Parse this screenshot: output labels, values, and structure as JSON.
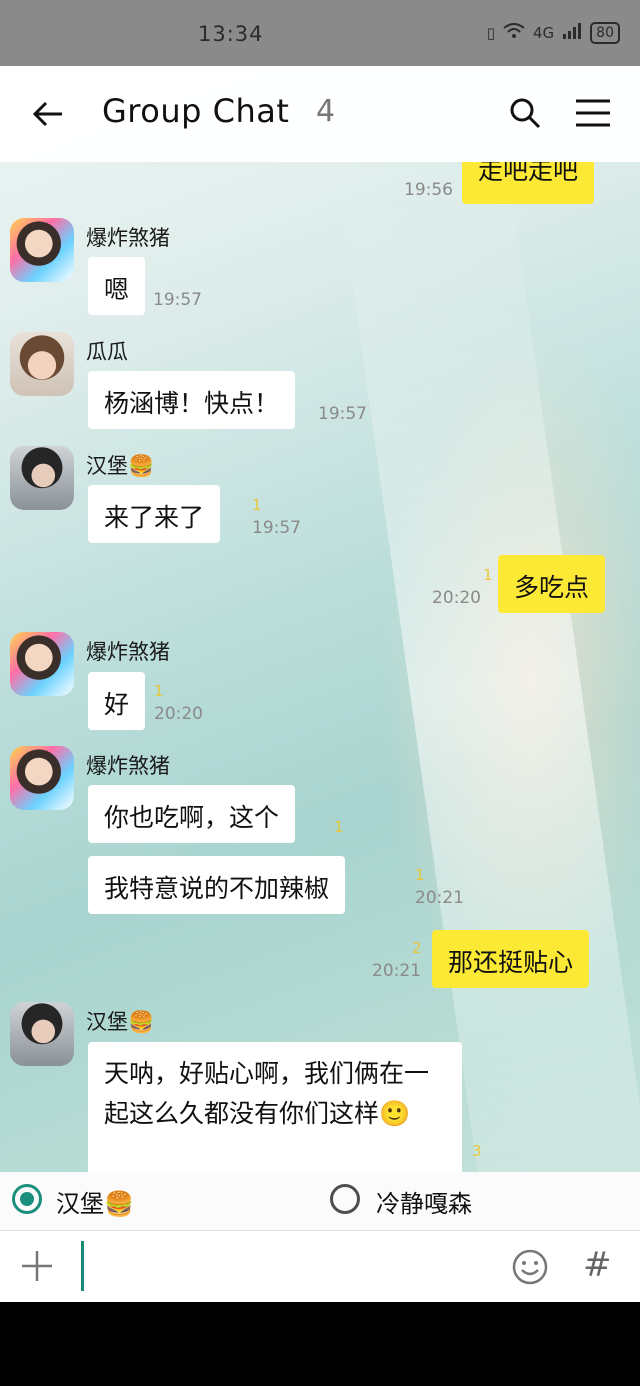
{
  "status_bar": {
    "time": "13:34",
    "network": "4G",
    "battery": "80"
  },
  "header": {
    "title": "Group Chat",
    "member_count": "4"
  },
  "messages": [
    {
      "side": "right",
      "text": "走吧走吧",
      "time": "19:56"
    },
    {
      "side": "left",
      "sender": "爆炸煞猪",
      "text": "嗯",
      "time": "19:57"
    },
    {
      "side": "left",
      "sender": "瓜瓜",
      "text": "杨涵博！快点！",
      "time": "19:57"
    },
    {
      "side": "left",
      "sender": "汉堡🍔",
      "text": "来了来了",
      "read": "1",
      "time": "19:57"
    },
    {
      "side": "right",
      "text": "多吃点",
      "read": "1",
      "time": "20:20"
    },
    {
      "side": "left",
      "sender": "爆炸煞猪",
      "text": "好",
      "read": "1",
      "time": "20:20"
    },
    {
      "side": "left",
      "sender": "爆炸煞猪",
      "text": "你也吃啊，这个",
      "read": "1"
    },
    {
      "side": "left",
      "text": "我特意说的不加辣椒",
      "read": "1",
      "time": "20:21"
    },
    {
      "side": "right",
      "text": "那还挺贴心",
      "read": "2",
      "time": "20:21"
    },
    {
      "side": "left",
      "sender": "汉堡🍔",
      "text": "天呐，好贴心啊，我们俩在一起这么久都没有你们这样🙂",
      "read": "3"
    }
  ],
  "send_as": {
    "options": [
      {
        "label": "汉堡🍔",
        "selected": true
      },
      {
        "label": "冷静嘎森",
        "selected": false
      }
    ]
  },
  "input": {
    "value": ""
  }
}
